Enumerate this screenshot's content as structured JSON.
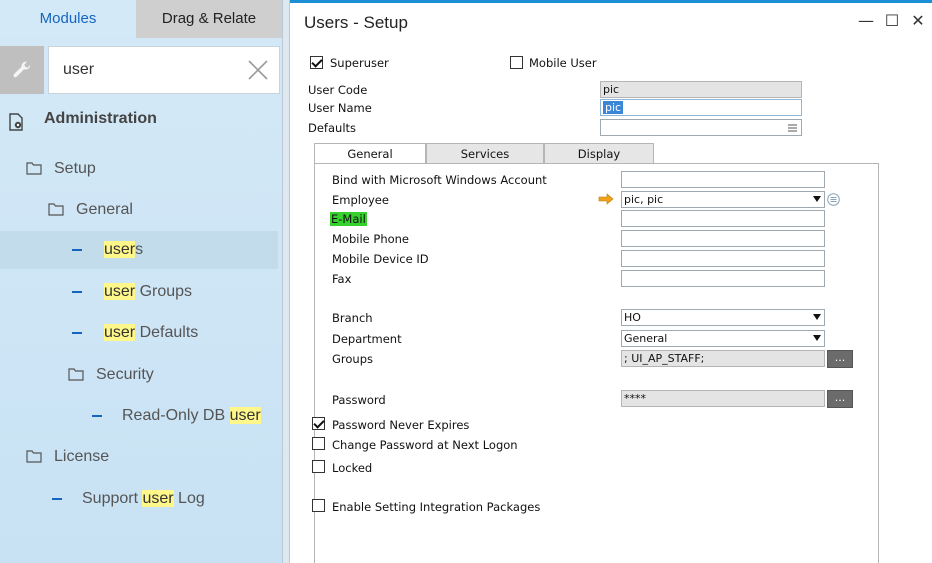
{
  "left_panel": {
    "tabs": [
      {
        "label": "Modules",
        "active": true
      },
      {
        "label": "Drag & Relate",
        "active": false
      }
    ],
    "search": {
      "value": "user"
    },
    "section": {
      "label": "Administration"
    },
    "tree": [
      {
        "label_pre": "Setup",
        "label_hl": "",
        "label_post": ""
      },
      {
        "label_pre": "General",
        "label_hl": "",
        "label_post": ""
      },
      {
        "label_pre": "",
        "label_hl": "user",
        "label_post": "s"
      },
      {
        "label_pre": "",
        "label_hl": "user",
        "label_post": " Groups"
      },
      {
        "label_pre": "",
        "label_hl": "user",
        "label_post": " Defaults"
      },
      {
        "label_pre": "Security",
        "label_hl": "",
        "label_post": ""
      },
      {
        "label_pre": "Read-Only DB ",
        "label_hl": "user",
        "label_post": ""
      },
      {
        "label_pre": "License",
        "label_hl": "",
        "label_post": ""
      },
      {
        "label_pre": "Support ",
        "label_hl": "user",
        "label_post": " Log"
      }
    ]
  },
  "window": {
    "title": "Users - Setup",
    "controls": {
      "minimize": "—",
      "maximize": "☐",
      "close": "✕"
    }
  },
  "header_fields": {
    "superuser": {
      "label": "Superuser",
      "checked": true
    },
    "mobile_user": {
      "label": "Mobile User",
      "checked": false
    },
    "user_code": {
      "label": "User Code",
      "value": "pic"
    },
    "user_name": {
      "label": "User Name",
      "value": "pic"
    },
    "defaults": {
      "label": "Defaults",
      "value": ""
    }
  },
  "tabs": [
    {
      "label": "General",
      "active": true
    },
    {
      "label": "Services",
      "active": false
    },
    {
      "label": "Display",
      "active": false
    }
  ],
  "general": {
    "bind_windows": {
      "label": "Bind with Microsoft Windows Account",
      "value": ""
    },
    "employee": {
      "label": "Employee",
      "value": "pic, pic"
    },
    "email": {
      "label": "E-Mail",
      "value": ""
    },
    "mobile_phone": {
      "label": "Mobile Phone",
      "value": ""
    },
    "mobile_device_id": {
      "label": "Mobile Device ID",
      "value": ""
    },
    "fax": {
      "label": "Fax",
      "value": ""
    },
    "branch": {
      "label": "Branch",
      "value": "HO"
    },
    "department": {
      "label": "Department",
      "value": "General"
    },
    "groups": {
      "label": "Groups",
      "value": "; UI_AP_STAFF;",
      "button": "..."
    },
    "password": {
      "label": "Password",
      "value": "****",
      "button": "..."
    },
    "password_never_expires": {
      "label": "Password Never Expires",
      "checked": true
    },
    "change_password": {
      "label": "Change Password at Next Logon",
      "checked": false
    },
    "locked": {
      "label": "Locked",
      "checked": false
    },
    "enable_integration": {
      "label": "Enable Setting Integration Packages",
      "checked": false
    }
  },
  "colors": {
    "accent": "#1a8fd6",
    "nav_bg": "#d4e9f7",
    "highlight": "#fff78a",
    "email_highlight": "#36d12c",
    "selection": "#3b86d6"
  },
  "icons": {
    "wrench": "wrench-icon",
    "clear": "close-icon",
    "admin": "administration-icon",
    "folder": "folder-icon",
    "arrow": "link-arrow-icon",
    "list": "list-icon"
  }
}
